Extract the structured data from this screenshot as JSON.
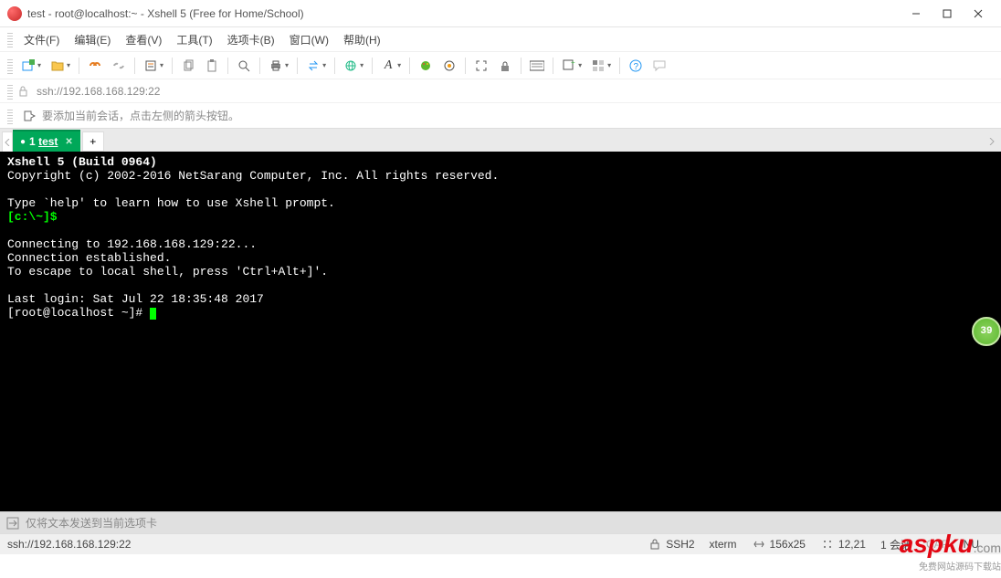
{
  "window": {
    "title": "test - root@localhost:~ - Xshell 5 (Free for Home/School)"
  },
  "menu": {
    "items": [
      "文件(F)",
      "编辑(E)",
      "查看(V)",
      "工具(T)",
      "选项卡(B)",
      "窗口(W)",
      "帮助(H)"
    ]
  },
  "address": {
    "url": "ssh://192.168.168.129:22"
  },
  "hint": {
    "text": "要添加当前会话，点击左侧的箭头按钮。"
  },
  "tabs": {
    "active": {
      "index": "1",
      "label": "test"
    }
  },
  "terminal": {
    "header_bold": "Xshell 5 (Build 0964)",
    "copyright": "Copyright (c) 2002-2016 NetSarang Computer, Inc. All rights reserved.",
    "help_line": "Type `help' to learn how to use Xshell prompt.",
    "local_prompt": "[c:\\~]$",
    "connecting": "Connecting to 192.168.168.129:22...",
    "established": "Connection established.",
    "escape": "To escape to local shell, press 'Ctrl+Alt+]'.",
    "last_login": "Last login: Sat Jul 22 18:35:48 2017",
    "shell_prompt": "[root@localhost ~]# "
  },
  "compose": {
    "placeholder": "仅将文本发送到当前选项卡"
  },
  "status": {
    "left": "ssh://192.168.168.129:22",
    "ssh": "SSH2",
    "term": "xterm",
    "size": "156x25",
    "cursor": "12,21",
    "extra1": "1 会话",
    "caps": "CAP",
    "num": "NU"
  },
  "badge": {
    "value": "39"
  },
  "watermark": {
    "main": "aspku",
    "suffix": ".com",
    "tagline": "免费网站源码下载站"
  }
}
